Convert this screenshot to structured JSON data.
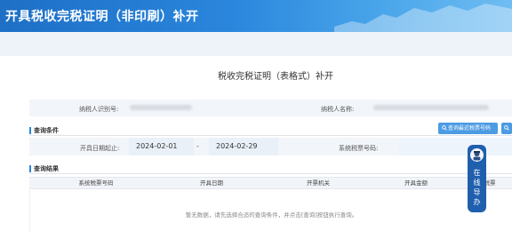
{
  "header": {
    "title": "开具税收完税证明（非印刷）补开"
  },
  "form": {
    "title": "税收完税证明（表格式）补开"
  },
  "taxpayer": {
    "id_label": "纳税人识别号:",
    "name_label": "纳税人名称:"
  },
  "query": {
    "section_title": "查询条件",
    "date_start_label": "开具日期起止:",
    "date_start": "2024-02-01",
    "date_sep": "-",
    "date_end": "2024-02-29",
    "sys_number_label": "系统税票号码:",
    "button_label": "查询最近税票号码"
  },
  "results": {
    "section_title": "查询结果",
    "columns": [
      "系统税票号码",
      "开具日期",
      "开票机关",
      "开具金额",
      "电子税票"
    ],
    "empty_text": "暂无数据，请先选择合适的查询条件，并点击[查询]按钮执行查询。"
  },
  "float_service": {
    "label": "在线导办"
  },
  "colors": {
    "accent": "#2a86dc",
    "button": "#4c9be3",
    "float_panel": "#1f5fae"
  },
  "icons": [
    "search-icon",
    "assistant-avatar-icon"
  ]
}
